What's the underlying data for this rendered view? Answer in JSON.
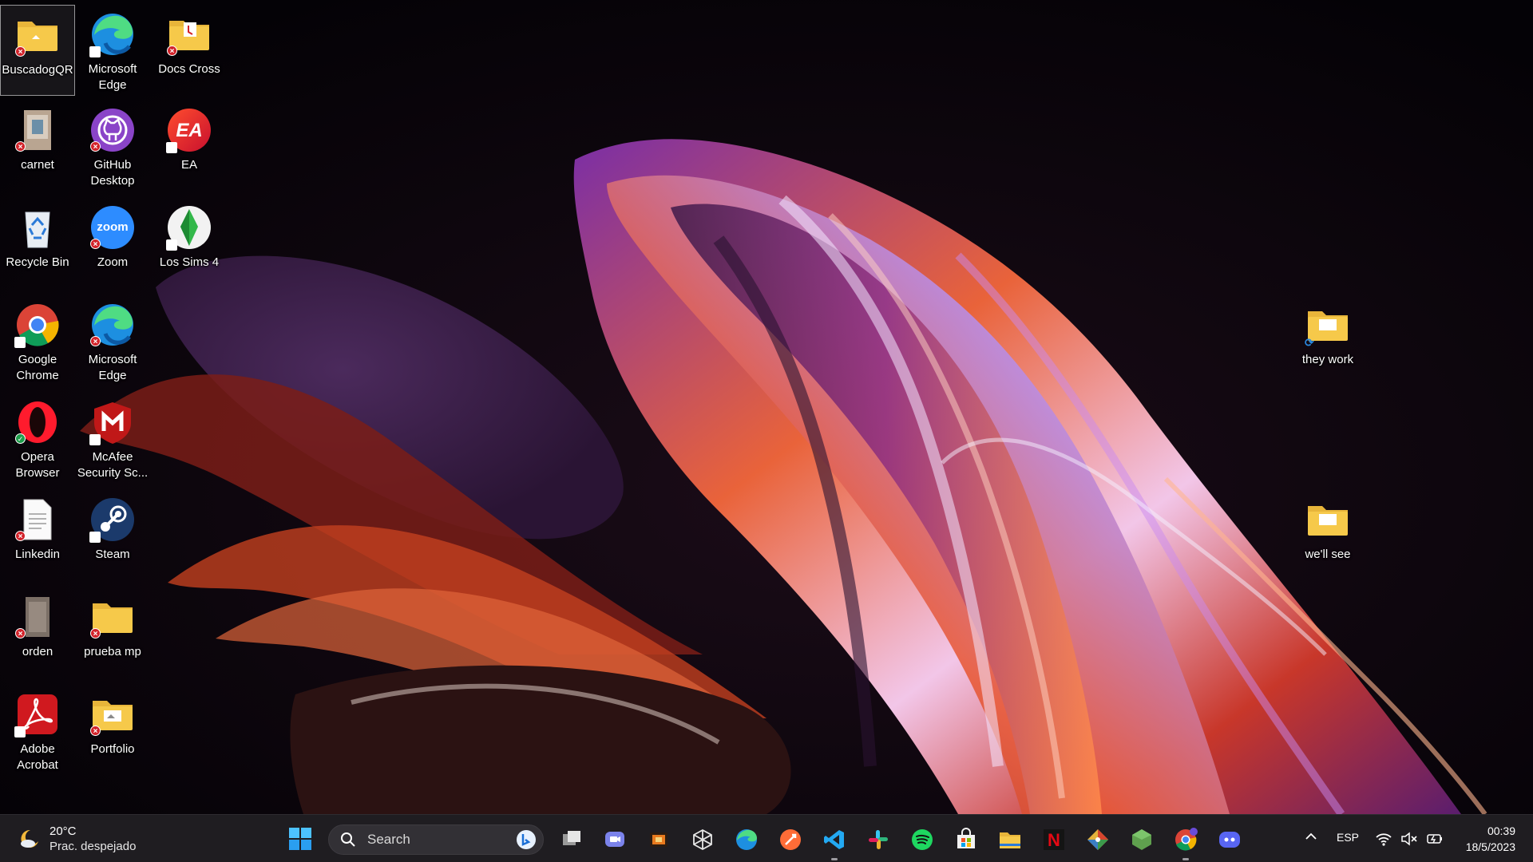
{
  "desktop": {
    "icons": [
      {
        "label": "BuscadogQR"
      },
      {
        "label": "Microsoft Edge"
      },
      {
        "label": "Docs Cross"
      },
      {
        "label": "carnet"
      },
      {
        "label": "GitHub Desktop"
      },
      {
        "label": "EA"
      },
      {
        "label": "Recycle Bin"
      },
      {
        "label": "Zoom"
      },
      {
        "label": "Los Sims 4"
      },
      {
        "label": "Google Chrome"
      },
      {
        "label": "Microsoft Edge"
      },
      {
        "label": "Opera Browser"
      },
      {
        "label": "McAfee Security Sc..."
      },
      {
        "label": "Linkedin"
      },
      {
        "label": "Steam"
      },
      {
        "label": "orden"
      },
      {
        "label": "prueba mp"
      },
      {
        "label": "Adobe Acrobat"
      },
      {
        "label": "Portfolio"
      },
      {
        "label": "they work"
      },
      {
        "label": "we'll see"
      }
    ],
    "zoom_icon_text": "zoom",
    "ea_icon_text": "EA"
  },
  "taskbar": {
    "weather": {
      "temp": "20°C",
      "desc": "Prac. despejado"
    },
    "search": {
      "placeholder": "Search"
    },
    "apps": [
      {
        "name": "task-view"
      },
      {
        "name": "teams-chat"
      },
      {
        "name": "photo-editor"
      },
      {
        "name": "app-network"
      },
      {
        "name": "microsoft-edge"
      },
      {
        "name": "postman"
      },
      {
        "name": "visual-studio-code"
      },
      {
        "name": "slack"
      },
      {
        "name": "spotify"
      },
      {
        "name": "microsoft-store"
      },
      {
        "name": "file-explorer"
      },
      {
        "name": "netflix"
      },
      {
        "name": "git"
      },
      {
        "name": "node-js"
      },
      {
        "name": "google-chrome"
      },
      {
        "name": "discord"
      }
    ],
    "tray": {
      "language": "ESP",
      "time": "00:39",
      "date": "18/5/2023"
    },
    "netflix_letter": "N"
  },
  "colors": {
    "taskbar_bg": "#1f1d21",
    "desktop_bg": "#050307",
    "folder_yellow": "#f6c94a",
    "error_badge": "#d2232a",
    "accent_blue": "#3a9cf0"
  }
}
